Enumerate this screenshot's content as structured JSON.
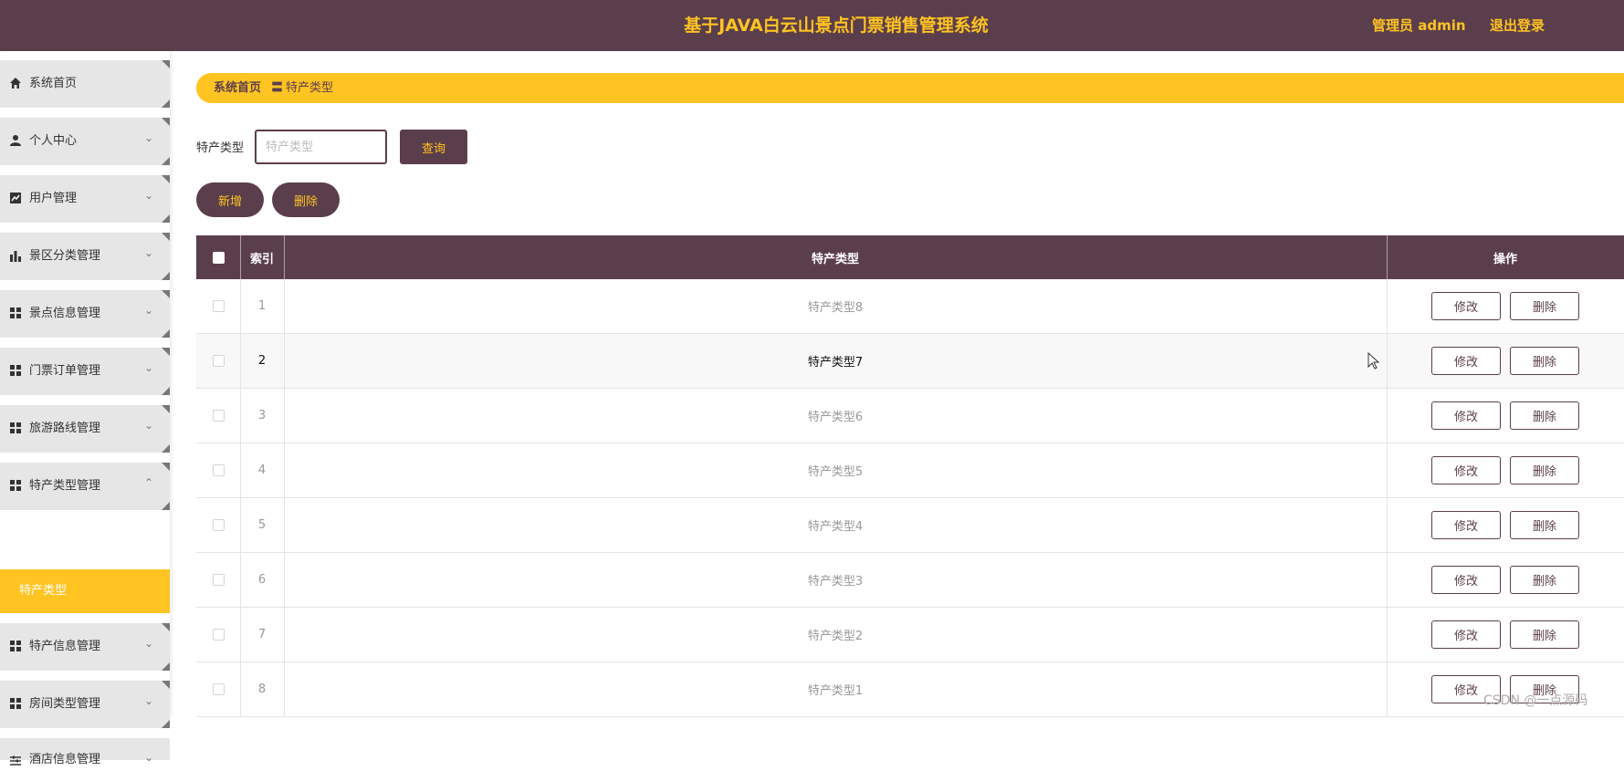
{
  "header": {
    "title": "基于JAVA白云山景点门票销售管理系统",
    "user": "管理员 admin",
    "logout": "退出登录"
  },
  "sidebar": {
    "items": [
      {
        "label": "系统首页",
        "icon": "home-icon"
      },
      {
        "label": "个人中心",
        "icon": "person-icon"
      },
      {
        "label": "用户管理",
        "icon": "chart-line-icon"
      },
      {
        "label": "景区分类管理",
        "icon": "bar-chart-icon"
      },
      {
        "label": "景点信息管理",
        "icon": "grid-icon"
      },
      {
        "label": "门票订单管理",
        "icon": "grid-icon"
      },
      {
        "label": "旅游路线管理",
        "icon": "grid-icon"
      },
      {
        "label": "特产类型管理",
        "icon": "grid-icon"
      },
      {
        "label": "特产信息管理",
        "icon": "grid-icon"
      },
      {
        "label": "房间类型管理",
        "icon": "grid-icon"
      },
      {
        "label": "酒店信息管理",
        "icon": "sliders-icon"
      }
    ],
    "active_sub": "特产类型"
  },
  "breadcrumb": {
    "home": "系统首页",
    "sep": "〓",
    "current": "特产类型"
  },
  "search": {
    "label": "特产类型",
    "placeholder": "特产类型",
    "button": "查询"
  },
  "actions": {
    "add": "新增",
    "delete": "删除"
  },
  "table": {
    "headers": {
      "index": "索引",
      "type": "特产类型",
      "ops": "操作"
    },
    "rows": [
      {
        "index": "1",
        "type": "特产类型8"
      },
      {
        "index": "2",
        "type": "特产类型7"
      },
      {
        "index": "3",
        "type": "特产类型6"
      },
      {
        "index": "4",
        "type": "特产类型5"
      },
      {
        "index": "5",
        "type": "特产类型4"
      },
      {
        "index": "6",
        "type": "特产类型3"
      },
      {
        "index": "7",
        "type": "特产类型2"
      },
      {
        "index": "8",
        "type": "特产类型1"
      }
    ],
    "edit_label": "修改",
    "delete_label": "删除"
  },
  "watermark": "CSDN @一点源码",
  "colors": {
    "primary": "#5b3e4b",
    "accent": "#ffc322"
  }
}
